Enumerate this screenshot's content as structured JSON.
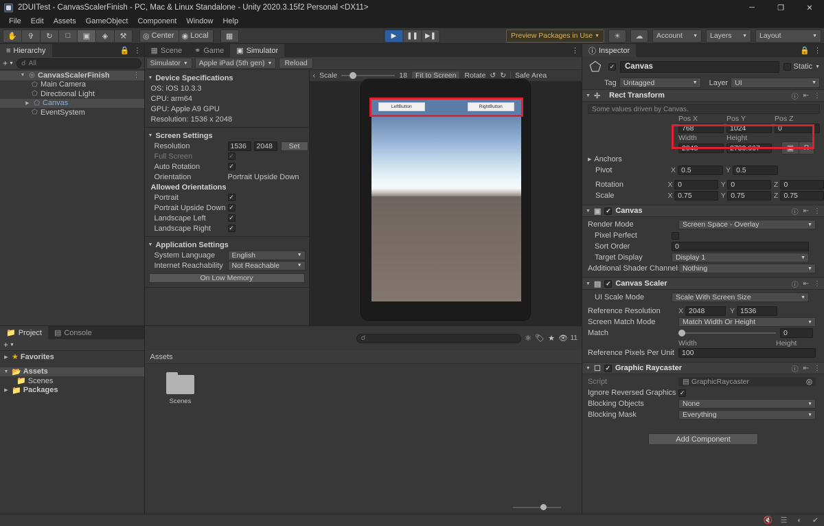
{
  "window": {
    "title": "2DUITest - CanvasScalerFinish - PC, Mac & Linux Standalone - Unity 2020.3.15f2 Personal <DX11>",
    "minimize": "─",
    "maximize": "❐",
    "close": "✕"
  },
  "menubar": [
    "File",
    "Edit",
    "Assets",
    "GameObject",
    "Component",
    "Window",
    "Help"
  ],
  "toolbar": {
    "tools": [
      "hand-icon",
      "move-icon",
      "rotate-icon",
      "scale-icon",
      "rect-icon",
      "transform-icon",
      "custom-icon"
    ],
    "pivot_label": "Center",
    "space_label": "Local",
    "play": "▶",
    "pause": "⏸",
    "step": "⏭",
    "preview_packages": "Preview Packages in Use",
    "account": "Account",
    "layers": "Layers",
    "layout": "Layout"
  },
  "hierarchy": {
    "tab": "Hierarchy",
    "search_placeholder": "All",
    "items": [
      {
        "label": "CanvasScalerFinish",
        "depth": 0,
        "arrow": "▼",
        "icon": "scene-icon",
        "selected": true,
        "bold": true
      },
      {
        "label": "Main Camera",
        "depth": 1,
        "arrow": "",
        "icon": "gameobject-icon",
        "selected": false,
        "bold": false
      },
      {
        "label": "Directional Light",
        "depth": 1,
        "arrow": "",
        "icon": "gameobject-icon",
        "selected": false,
        "bold": false
      },
      {
        "label": "Canvas",
        "depth": 1,
        "arrow": "▶",
        "icon": "gameobject-icon",
        "selected": true,
        "bold": false
      },
      {
        "label": "EventSystem",
        "depth": 1,
        "arrow": "",
        "icon": "gameobject-icon",
        "selected": false,
        "bold": false
      }
    ]
  },
  "simulator": {
    "tabs": [
      {
        "label": "Scene",
        "active": false,
        "icon": "grid-icon"
      },
      {
        "label": "Game",
        "active": false,
        "icon": "gamepad-icon"
      },
      {
        "label": "Simulator",
        "active": true,
        "icon": "device-icon"
      }
    ],
    "mode": "Simulator",
    "device": "Apple iPad (5th gen)",
    "reload": "Reload",
    "device_specs": {
      "header": "Device Specifications",
      "os": "OS: iOS 10.3.3",
      "cpu": "CPU: arm64",
      "gpu": "GPU: Apple A9 GPU",
      "resolution": "Resolution: 1536 x 2048"
    },
    "screen_settings": {
      "header": "Screen Settings",
      "resolution_label": "Resolution",
      "resolution_w": "1536",
      "resolution_h": "2048",
      "set_label": "Set",
      "full_screen_label": "Full Screen",
      "full_screen_checked": true,
      "auto_rotation_label": "Auto Rotation",
      "auto_rotation_checked": true,
      "orientation_label": "Orientation",
      "orientation_value": "Portrait Upside Down",
      "allowed_header": "Allowed Orientations",
      "allowed": [
        {
          "label": "Portrait",
          "checked": true
        },
        {
          "label": "Portrait Upside Down",
          "checked": true
        },
        {
          "label": "Landscape Left",
          "checked": true
        },
        {
          "label": "Landscape Right",
          "checked": true
        }
      ]
    },
    "application_settings": {
      "header": "Application Settings",
      "system_language_label": "System Language",
      "system_language_value": "English",
      "internet_label": "Internet Reachability",
      "internet_value": "Not Reachable",
      "on_low_memory": "On Low Memory"
    },
    "view_toolbar": {
      "back": "‹",
      "scale_label": "Scale",
      "scale_value": "18",
      "fit_to_screen": "Fit to Screen",
      "rotate_label": "Rotate",
      "safe_area": "Safe Area"
    },
    "game_ui": {
      "left_button": "LeftButton",
      "right_button": "RightButton"
    }
  },
  "project": {
    "tabs": [
      {
        "label": "Project",
        "active": true,
        "icon": "folder-icon"
      },
      {
        "label": "Console",
        "active": false,
        "icon": "console-icon"
      }
    ],
    "search_placeholder": "",
    "badge_count": "11",
    "tree": [
      {
        "label": "Favorites",
        "arrow": "▶",
        "icon": "star-icon",
        "depth": 0,
        "selected": false,
        "bold": true
      },
      {
        "label": "Assets",
        "arrow": "▼",
        "icon": "folder-open-icon",
        "depth": 0,
        "selected": true,
        "bold": true
      },
      {
        "label": "Scenes",
        "arrow": "",
        "icon": "folder-icon",
        "depth": 1,
        "selected": false,
        "bold": false
      },
      {
        "label": "Packages",
        "arrow": "▶",
        "icon": "folder-icon",
        "depth": 0,
        "selected": false,
        "bold": true
      }
    ],
    "breadcrumb": "Assets",
    "assets": [
      {
        "label": "Scenes",
        "type": "folder"
      }
    ]
  },
  "inspector": {
    "tab": "Inspector",
    "object_name": "Canvas",
    "enabled": true,
    "static_label": "Static",
    "tag_label": "Tag",
    "tag_value": "Untagged",
    "layer_label": "Layer",
    "layer_value": "UI",
    "rect_transform": {
      "title": "Rect Transform",
      "note": "Some values driven by Canvas.",
      "pos_x_label": "Pos X",
      "pos_y_label": "Pos Y",
      "pos_z_label": "Pos Z",
      "pos_x": "768",
      "pos_y": "1024",
      "pos_z": "0",
      "width_label": "Width",
      "height_label": "Height",
      "width": "2048",
      "height": "2730.667",
      "anchors_label": "Anchors",
      "pivot_label": "Pivot",
      "pivot_x": "0.5",
      "pivot_y": "0.5",
      "rotation_label": "Rotation",
      "rot_x": "0",
      "rot_y": "0",
      "rot_z": "0",
      "scale_label": "Scale",
      "scale_x": "0.75",
      "scale_y": "0.75",
      "scale_z": "0.75",
      "blueprint_label": "R"
    },
    "canvas": {
      "title": "Canvas",
      "render_mode_label": "Render Mode",
      "render_mode_value": "Screen Space - Overlay",
      "pixel_perfect_label": "Pixel Perfect",
      "pixel_perfect_checked": false,
      "sort_order_label": "Sort Order",
      "sort_order_value": "0",
      "target_display_label": "Target Display",
      "target_display_value": "Display 1",
      "shader_channels_label": "Additional Shader Channels",
      "shader_channels_value": "Nothing"
    },
    "canvas_scaler": {
      "title": "Canvas Scaler",
      "ui_scale_mode_label": "UI Scale Mode",
      "ui_scale_mode_value": "Scale With Screen Size",
      "ref_res_label": "Reference Resolution",
      "ref_res_x": "2048",
      "ref_res_y": "1536",
      "match_mode_label": "Screen Match Mode",
      "match_mode_value": "Match Width Or Height",
      "match_label": "Match",
      "match_value": "0",
      "match_min": "Width",
      "match_max": "Height",
      "ref_ppu_label": "Reference Pixels Per Unit",
      "ref_ppu_value": "100"
    },
    "graphic_raycaster": {
      "title": "Graphic Raycaster",
      "script_label": "Script",
      "script_value": "GraphicRaycaster",
      "ignore_label": "Ignore Reversed Graphics",
      "ignore_checked": true,
      "blocking_objects_label": "Blocking Objects",
      "blocking_objects_value": "None",
      "blocking_mask_label": "Blocking Mask",
      "blocking_mask_value": "Everything"
    },
    "add_component": "Add Component"
  },
  "statusbar": {
    "icons": [
      "mute-audio-icon",
      "layers-off-icon",
      "gizmos-off-icon",
      "check-icon"
    ]
  },
  "colors": {
    "accent_red": "#e0212f",
    "play_blue": "#2c5d9e",
    "preview_gold": "#d8b45a",
    "panel_bg": "#383838",
    "window_bg": "#1f1f1f"
  }
}
